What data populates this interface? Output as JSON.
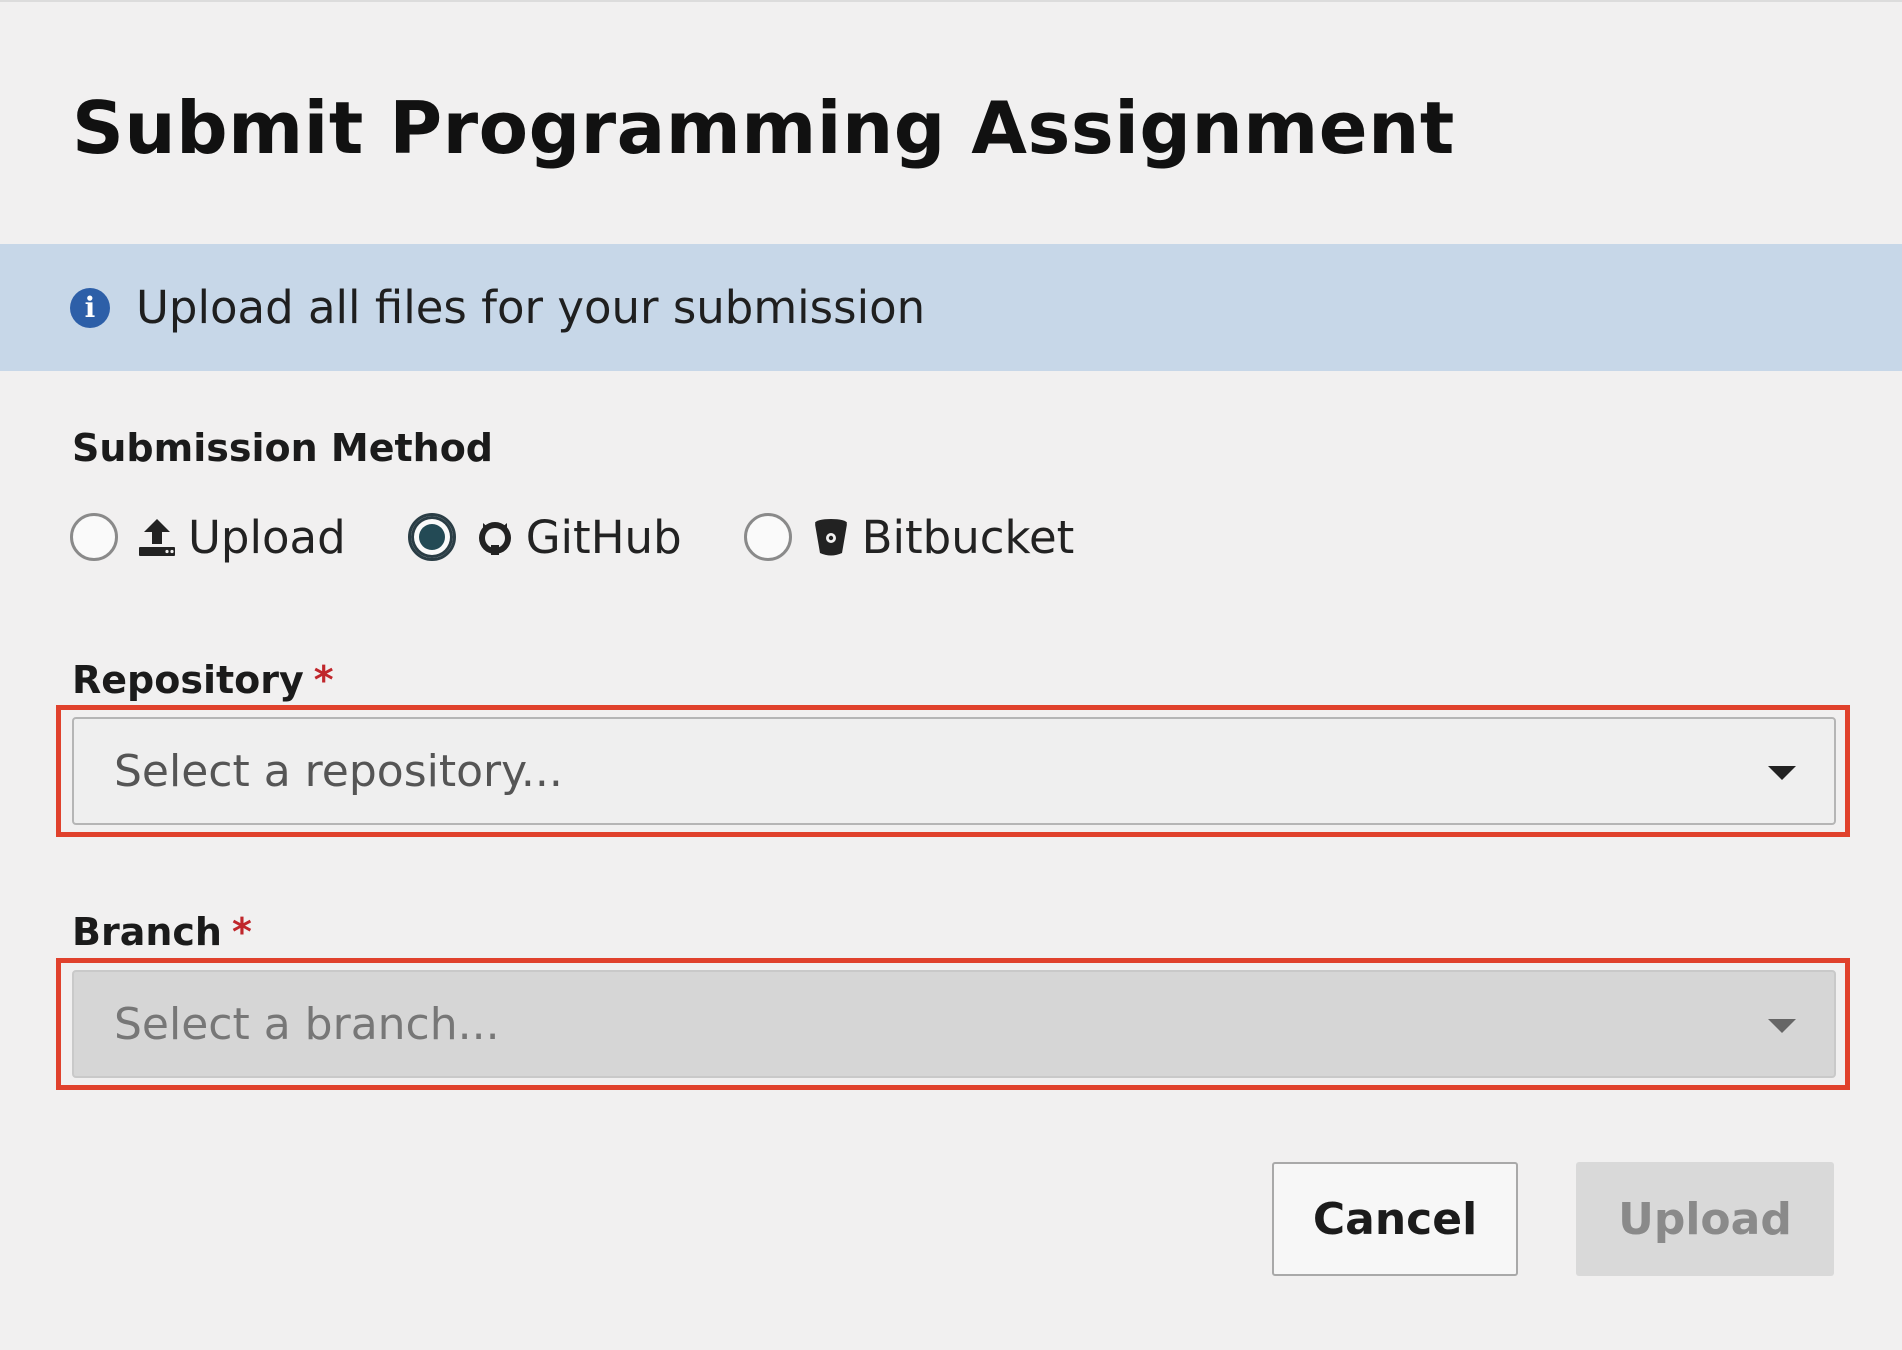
{
  "dialog": {
    "title": "Submit Programming Assignment"
  },
  "banner": {
    "icon": "info-icon",
    "text": "Upload all files for your submission"
  },
  "submission_method": {
    "label": "Submission Method",
    "options": [
      {
        "label": "Upload",
        "icon": "upload-icon",
        "checked": false
      },
      {
        "label": "GitHub",
        "icon": "github-icon",
        "checked": true
      },
      {
        "label": "Bitbucket",
        "icon": "bitbucket-icon",
        "checked": false
      }
    ]
  },
  "repository": {
    "label": "Repository",
    "required_mark": "*",
    "placeholder": "Select a repository..."
  },
  "branch": {
    "label": "Branch",
    "required_mark": "*",
    "placeholder": "Select a branch...",
    "disabled": true
  },
  "actions": {
    "cancel_label": "Cancel",
    "upload_label": "Upload",
    "upload_disabled": true
  },
  "colors": {
    "banner_bg": "#c7d7e8",
    "info_icon": "#2d5fa8",
    "required": "#c0262b",
    "highlight_outline": "#e0412c",
    "radio_checked": "#234a55"
  }
}
